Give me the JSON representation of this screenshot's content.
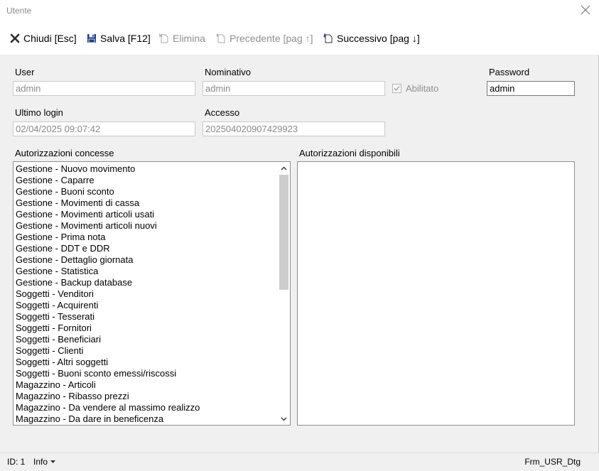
{
  "window": {
    "title": "Utente"
  },
  "toolbar": {
    "close_label": "Chiudi [Esc]",
    "save_label": "Salva [F12]",
    "delete_label": "Elimina",
    "previous_label": "Precedente [pag ↑]",
    "next_label": "Successivo [pag ↓]",
    "icons": {
      "close": "x-icon",
      "save": "floppy-disk-icon",
      "delete": "document-delete-icon",
      "previous": "document-previous-icon",
      "next": "document-next-icon"
    }
  },
  "form": {
    "user_label": "User",
    "user_value": "admin",
    "nominativo_label": "Nominativo",
    "nominativo_value": "admin",
    "abilitato_label": "Abilitato",
    "abilitato_checked": true,
    "password_label": "Password",
    "password_value": "admin",
    "ultimo_login_label": "Ultimo login",
    "ultimo_login_value": "02/04/2025 09:07:42",
    "accesso_label": "Accesso",
    "accesso_value": "20250402090742992З",
    "concesse_label": "Autorizzazioni concesse",
    "disponibili_label": "Autorizzazioni disponibili"
  },
  "autorizzazioni_concesse": [
    "Gestione - Nuovo movimento",
    "Gestione - Caparre",
    "Gestione - Buoni sconto",
    "Gestione - Movimenti di cassa",
    "Gestione - Movimenti articoli usati",
    "Gestione - Movimenti articoli nuovi",
    "Gestione - Prima nota",
    "Gestione - DDT e DDR",
    "Gestione - Dettaglio giornata",
    "Gestione - Statistica",
    "Gestione - Backup database",
    "Soggetti - Venditori",
    "Soggetti - Acquirenti",
    "Soggetti - Tesserati",
    "Soggetti - Fornitori",
    "Soggetti - Beneficiari",
    "Soggetti - Clienti",
    "Soggetti - Altri soggetti",
    "Soggetti - Buoni sconto emessi/riscossi",
    "Magazzino - Articoli",
    "Magazzino - Ribasso prezzi",
    "Magazzino - Da vendere al massimo realizzo",
    "Magazzino - Da dare in beneficenza"
  ],
  "autorizzazioni_disponibili": [],
  "statusbar": {
    "id_text": "ID: 1",
    "info_label": "Info",
    "form_name": "Frm_USR_Dtg"
  }
}
